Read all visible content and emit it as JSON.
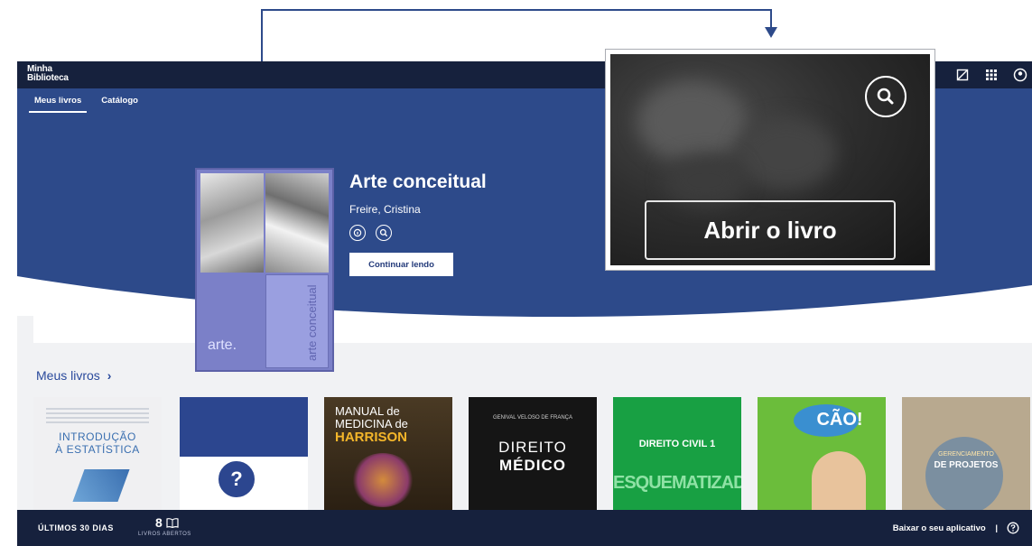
{
  "app": {
    "logo_line1": "Minha",
    "logo_line2": "Biblioteca"
  },
  "tabs": [
    {
      "label": "Meus livros",
      "active": true
    },
    {
      "label": "Catálogo",
      "active": false
    }
  ],
  "featured_book": {
    "title": "Arte conceitual",
    "author": "Freire, Cristina",
    "continue_label": "Continuar lendo",
    "cover_spine_text": "arte conceitual",
    "cover_logo_text": "arte."
  },
  "callout": {
    "open_book_label": "Abrir o livro"
  },
  "my_books": {
    "heading": "Meus livros",
    "chevron": "›",
    "items": [
      {
        "lines": [
          "INTRODUÇÃO",
          "À ESTATÍSTICA"
        ],
        "bg": "#f0f0f2",
        "fg": "#3a6fb0"
      },
      {
        "lines": [
          "?"
        ],
        "bg": "#2c468f",
        "fg": "#2c468f"
      },
      {
        "lines": [
          "MANUAL de",
          "MEDICINA de",
          "HARRISON"
        ],
        "bg": "#3a2d1c",
        "fg": "#ffffff"
      },
      {
        "lines": [
          "DIREITO",
          "MÉDICO"
        ],
        "bg": "#1a1a1a",
        "fg": "#ffffff"
      },
      {
        "lines": [
          "DIREITO CIVIL 1",
          "ESQUEMATIZADO"
        ],
        "bg": "#18a043",
        "fg": "#ffffff"
      },
      {
        "lines": [
          "CÃO!"
        ],
        "bg": "#6bbd3b",
        "fg": "#ffffff"
      },
      {
        "lines": [
          "GERENCIAMENTO",
          "DE PROJETOS"
        ],
        "bg": "#b8a98f",
        "fg": "#ffffff"
      }
    ]
  },
  "bottom_bar": {
    "days_label": "ÚLTIMOS 30 DIAS",
    "books_count": "8",
    "books_label": "LIVROS ABERTOS",
    "download_label": "Baixar o seu aplicativo",
    "separator": "|"
  },
  "colors": {
    "hero_blue": "#2d4a8a",
    "topbar": "#16213d",
    "accent_text": "#2a4a9c",
    "arrow": "#2d4a8a"
  }
}
